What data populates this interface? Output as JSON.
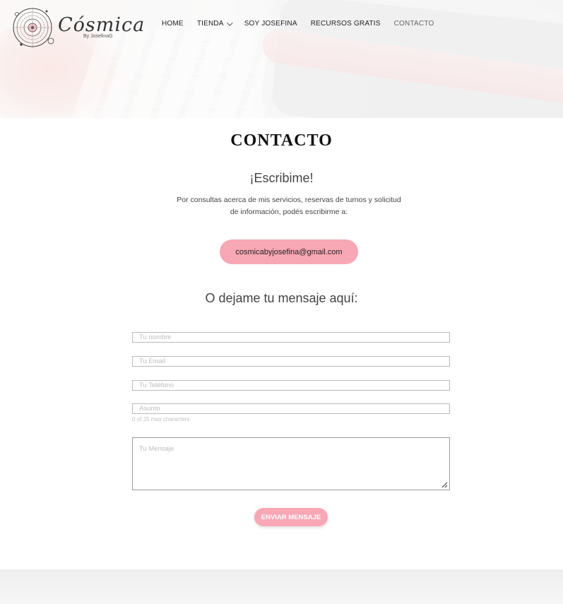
{
  "header": {
    "logo": {
      "wordmark": "Cósmica",
      "byline": "By JosefinaG"
    },
    "nav": [
      {
        "label": "HOME",
        "dropdown": false,
        "active": false
      },
      {
        "label": "TIENDA",
        "dropdown": true,
        "active": false
      },
      {
        "label": "SOY JOSEFINA",
        "dropdown": false,
        "active": false
      },
      {
        "label": "RECURSOS GRATIS",
        "dropdown": false,
        "active": false
      },
      {
        "label": "CONTACTO",
        "dropdown": false,
        "active": true
      }
    ]
  },
  "main": {
    "title": "CONTACTO",
    "subtitle": "¡Escribime!",
    "intro_line1": "Por consultas acerca de mis servicios, reservas de turnos y solicitud",
    "intro_line2": "de información, podés escribirme a:",
    "email_button": "cosmicabyjosefina@gmail.com",
    "form_title": "O dejame tu mensaje aquí:"
  },
  "form": {
    "name": {
      "placeholder": "Tu nombre",
      "value": ""
    },
    "email": {
      "placeholder": "Tu Email",
      "value": ""
    },
    "phone": {
      "placeholder": "Tu Teléfono",
      "value": ""
    },
    "subject": {
      "placeholder": "Asunto",
      "value": "",
      "counter": "0 of 25 max characters."
    },
    "message": {
      "placeholder": "Tu Mensaje",
      "value": ""
    },
    "submit_label": "ENVIAR MENSAJE"
  },
  "colors": {
    "accent_pink": "#f8a7b4",
    "text_dark": "#111111",
    "text_body": "#444444"
  }
}
